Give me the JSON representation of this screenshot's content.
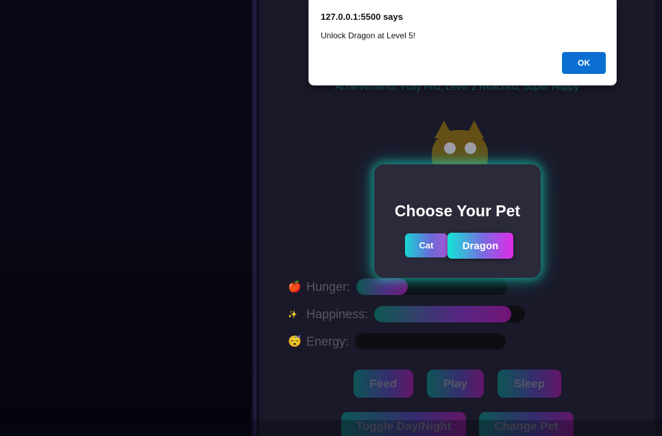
{
  "achievements": {
    "text": "Achievements: Fully Fed, Level 2 Reached, Super Happy"
  },
  "stats": [
    {
      "icon": "🍎",
      "icon_name": "apple-icon",
      "label": "Hunger:",
      "value": 0.34
    },
    {
      "icon": "✨",
      "icon_name": "sparkles-icon",
      "label": "Happiness:",
      "value": 0.91
    },
    {
      "icon": "😴",
      "icon_name": "sleeping-face-icon",
      "label": "Energy:",
      "value": 0.0
    }
  ],
  "actions": {
    "feed": "Feed",
    "play": "Play",
    "sleep": "Sleep",
    "toggle_day_night": "Toggle Day/Night",
    "change_pet": "Change Pet"
  },
  "modal": {
    "title": "Choose Your Pet",
    "options": [
      "Cat",
      "Dragon"
    ]
  },
  "alert": {
    "title": "127.0.0.1:5500 says",
    "message": "Unlock Dragon at Level 5!",
    "ok_label": "OK"
  },
  "colors": {
    "accent_cyan": "#12e6d6",
    "accent_magenta": "#e02be8",
    "alert_button": "#0a6fd1"
  }
}
